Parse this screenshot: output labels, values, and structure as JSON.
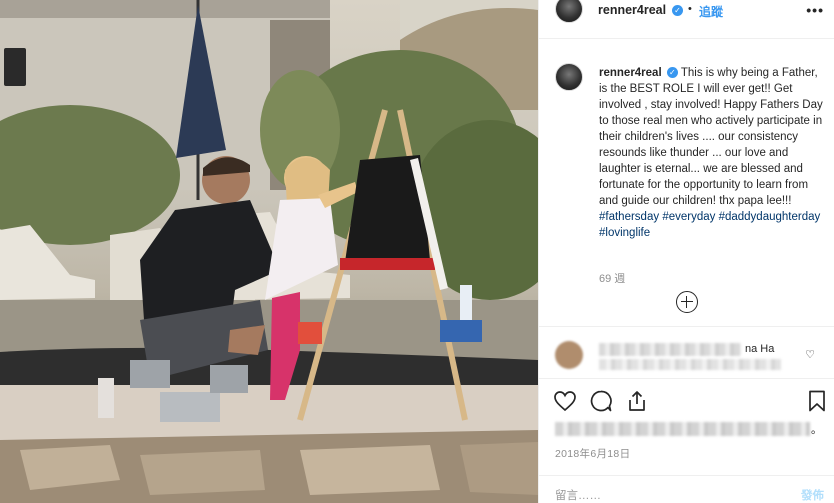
{
  "post": {
    "username": "renner4real",
    "verified_icon": "verified-badge-icon",
    "separator": "•",
    "follow_label": "追蹤",
    "more_label": "•••",
    "caption_username": "renner4real",
    "caption_text": "This is why being a Father, is the BEST ROLE I will ever get!! Get involved , stay involved! Happy Fathers Day to those real men who actively participate in their children's lives .... our consistency resounds like thunder ... our love and laughter is eternal... we are blessed and fortunate for the opportunity to learn from and guide our children! thx papa lee!!! ",
    "hashtags": [
      "#fathersday",
      "#everyday",
      "#daddydaughterday",
      "#lovinglife"
    ],
    "time_ago": "69 週",
    "comment_suffix": "na Ha",
    "likes_suffix": "。",
    "date": "2018年6月18日",
    "comment_placeholder": "留言……",
    "post_label": "發佈"
  },
  "icons": {
    "like": "heart-outline-icon",
    "comment": "comment-bubble-icon",
    "share": "share-icon",
    "save": "bookmark-icon",
    "load_more": "plus-circle-icon",
    "comment_like": "small-heart-icon"
  },
  "colors": {
    "link": "#3897f0",
    "hashtag": "#003569",
    "muted": "#8e8e8e",
    "post_disabled": "#b2dffc"
  }
}
